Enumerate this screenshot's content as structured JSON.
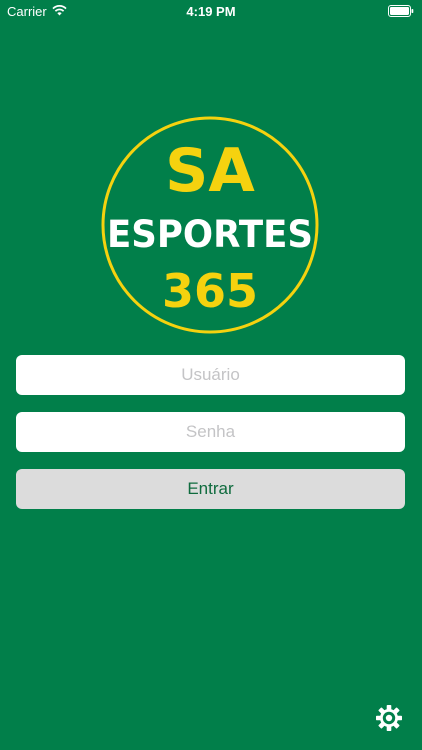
{
  "status_bar": {
    "carrier": "Carrier",
    "time": "4:19 PM",
    "wifi_icon": "wifi-icon",
    "battery_icon": "battery-icon"
  },
  "logo": {
    "line1": "SA",
    "line2": "ESPORTES",
    "line3": "365",
    "ring_color": "#f5d20f",
    "text_colors": {
      "line1": "#f5d20f",
      "line2": "#ffffff",
      "line3": "#f5d20f"
    }
  },
  "login": {
    "username_placeholder": "Usuário",
    "password_placeholder": "Senha",
    "submit_label": "Entrar"
  },
  "settings": {
    "icon": "gear-icon"
  },
  "colors": {
    "background": "#017f4a",
    "field_background": "#ffffff",
    "button_background": "#dcdcdc",
    "button_text": "#0f6b3e",
    "placeholder_text": "#c4c4c6"
  }
}
